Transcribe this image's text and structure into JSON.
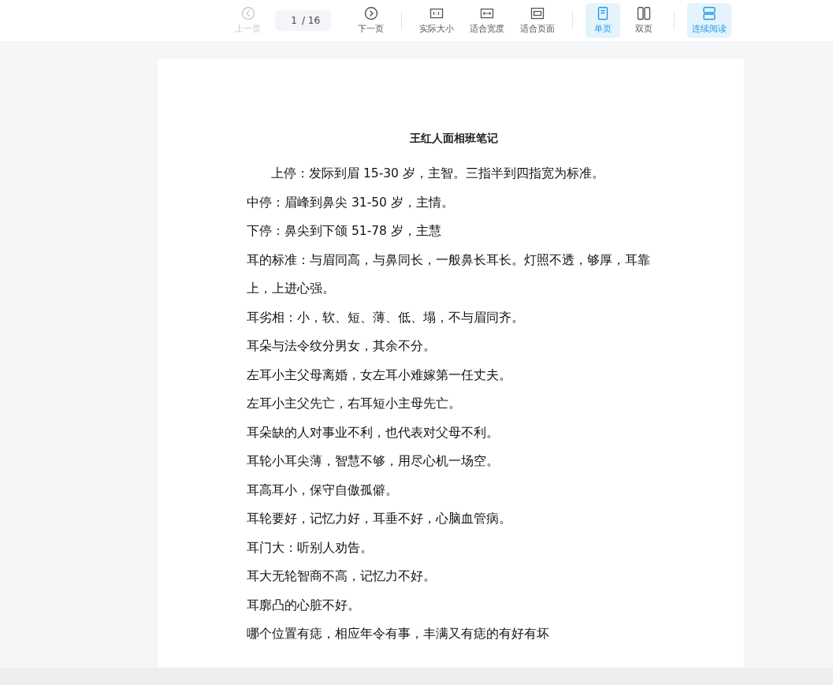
{
  "toolbar": {
    "buttons": [
      {
        "kind": "nav",
        "label": "上一页",
        "disabled": true
      },
      {
        "kind": "pager",
        "value": "1",
        "total": "/ 16"
      },
      {
        "kind": "nav",
        "label": "下一页",
        "disabled": false
      },
      {
        "kind": "divider"
      },
      {
        "kind": "zoom",
        "label": "实际大小"
      },
      {
        "kind": "zoom",
        "label": "适合宽度"
      },
      {
        "kind": "zoom",
        "label": "适合页面"
      },
      {
        "kind": "divider"
      },
      {
        "kind": "view",
        "label": "单页",
        "selected": true
      },
      {
        "kind": "view",
        "label": "双页",
        "selected": false
      },
      {
        "kind": "divider"
      },
      {
        "kind": "view",
        "label": "连续阅读",
        "selected": true
      }
    ]
  },
  "document": {
    "title": "王红人面相班笔记",
    "paragraphs": [
      {
        "text": "上停：发际到眉 15-30 岁，主智。三指半到四指宽为标准。",
        "indent": true
      },
      {
        "text": "中停：眉峰到鼻尖 31-50 岁，主情。",
        "indent": false
      },
      {
        "text": "下停：鼻尖到下颌  51-78 岁，主慧",
        "indent": false
      },
      {
        "text": "耳的标准：与眉同高，与鼻同长，一般鼻长耳长。灯照不透，够厚，耳靠上，上进心强。",
        "indent": false
      },
      {
        "text": "耳劣相：小，软、短、薄、低、塌，不与眉同齐。",
        "indent": false
      },
      {
        "text": "耳朵与法令纹分男女，其余不分。",
        "indent": false
      },
      {
        "text": "左耳小主父母离婚，女左耳小难嫁第一任丈夫。",
        "indent": false
      },
      {
        "text": "左耳小主父先亡，右耳短小主母先亡。",
        "indent": false
      },
      {
        "text": "耳朵缺的人对事业不利，也代表对父母不利。",
        "indent": false
      },
      {
        "text": "耳轮小耳尖薄，智慧不够，用尽心机一场空。",
        "indent": false
      },
      {
        "text": "耳高耳小，保守自傲孤僻。",
        "indent": false
      },
      {
        "text": "耳轮要好，记忆力好，耳垂不好，心脑血管病。",
        "indent": false
      },
      {
        "text": "耳门大：听别人劝告。",
        "indent": false
      },
      {
        "text": "耳大无轮智商不高，记忆力不好。",
        "indent": false
      },
      {
        "text": "耳廓凸的心脏不好。",
        "indent": false
      },
      {
        "text": "哪个位置有痣，相应年令有事，丰满又有痣的有好有坏",
        "indent": false
      }
    ]
  }
}
